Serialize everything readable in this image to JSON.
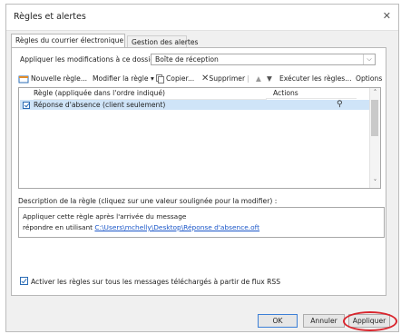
{
  "window": {
    "title": "Règles et alertes",
    "close_glyph": "✕"
  },
  "tabs": [
    {
      "label": "Règles du courrier électronique",
      "active": true
    },
    {
      "label": "Gestion des alertes",
      "active": false
    }
  ],
  "folder": {
    "label": "Appliquer les modifications à ce dossier :",
    "value": "Boîte de réception"
  },
  "toolbar": {
    "new_rule": "Nouvelle règle...",
    "modify_rule": "Modifier la règle",
    "copy": "Copier...",
    "delete": "Supprimer",
    "run_rules": "Exécuter les règles...",
    "options": "Options"
  },
  "rules_table": {
    "col_rule": "Règle (appliquée dans l'ordre indiqué)",
    "col_actions": "Actions",
    "rows": [
      {
        "checked": true,
        "label": "Réponse d'absence  (client seulement)"
      }
    ]
  },
  "description": {
    "label": "Description de la règle (cliquez sur une valeur soulignée pour la modifier) :",
    "line1": "Appliquer cette règle après l'arrivée du message",
    "line2_prefix": "répondre en utilisant ",
    "line2_link": "C:\\Users\\mchelly\\Desktop\\Réponse d'absence.oft"
  },
  "rss": {
    "checked": true,
    "label": "Activer les règles sur tous les messages téléchargés à partir de flux RSS"
  },
  "buttons": {
    "ok": "OK",
    "cancel": "Annuler",
    "apply": "Appliquer"
  },
  "colors": {
    "highlight_row": "#cfe4f8",
    "annotation": "#d9262e",
    "link": "#1a56c8"
  }
}
